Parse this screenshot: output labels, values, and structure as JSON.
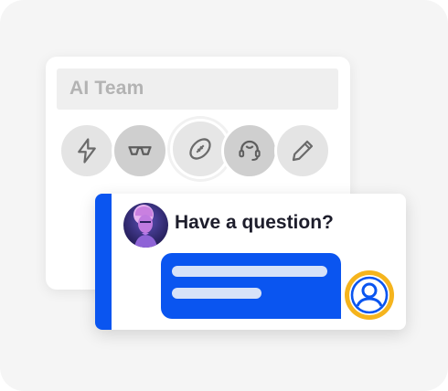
{
  "team_card": {
    "title": "AI Team",
    "members": [
      {
        "icon": "lightning-icon"
      },
      {
        "icon": "glasses-icon"
      },
      {
        "icon": "football-icon"
      },
      {
        "icon": "headset-icon"
      },
      {
        "icon": "pencil-icon"
      }
    ]
  },
  "chat": {
    "title": "Have a question?",
    "bot_avatar": "bot-portrait-avatar",
    "user_avatar": "user-icon"
  },
  "colors": {
    "accent_blue": "#0a55f0",
    "user_ring_yellow": "#f5b41d",
    "title_gray": "#b3b3b3"
  }
}
